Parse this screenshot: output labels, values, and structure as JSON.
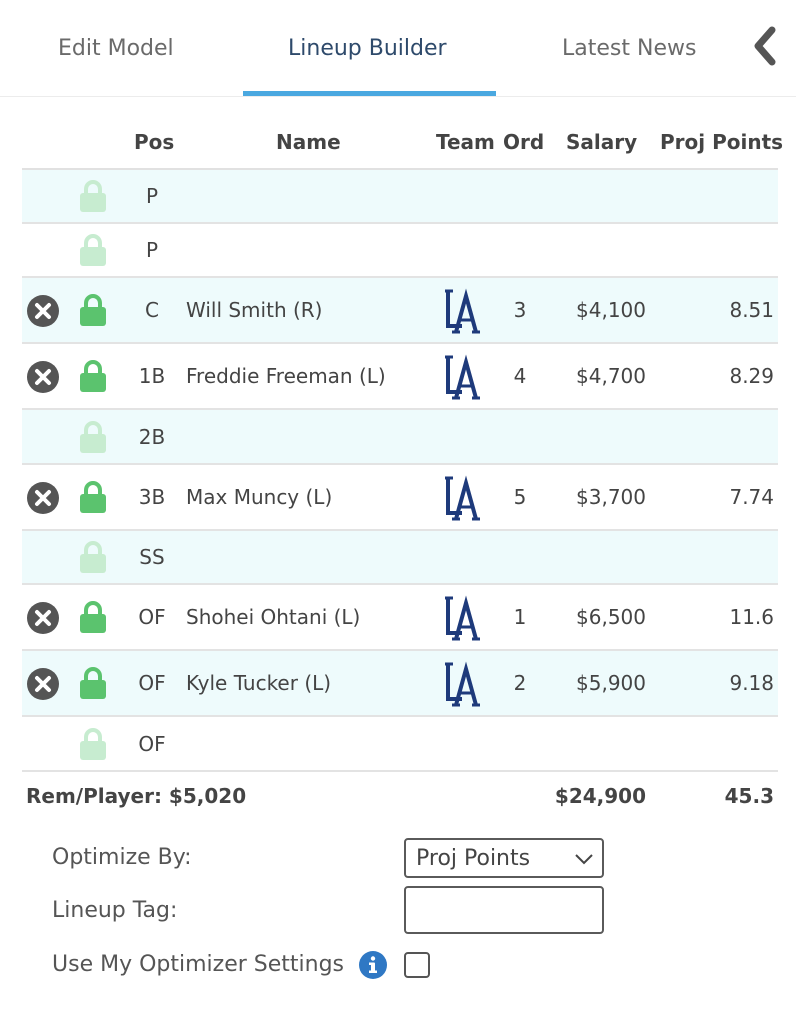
{
  "tabs": [
    {
      "label": "Edit Model"
    },
    {
      "label": "Lineup Builder"
    },
    {
      "label": "Latest News"
    }
  ],
  "table": {
    "headers": {
      "pos": "Pos",
      "name": "Name",
      "team": "Team",
      "ord": "Ord",
      "salary": "Salary",
      "proj_points": "Proj Points"
    },
    "rows": [
      {
        "pos": "P",
        "filled": false
      },
      {
        "pos": "P",
        "filled": false
      },
      {
        "pos": "C",
        "filled": true,
        "name": "Will Smith (R)",
        "team_icon": "dodgers-la-logo",
        "ord": "3",
        "salary": "$4,100",
        "proj_points": "8.51"
      },
      {
        "pos": "1B",
        "filled": true,
        "name": "Freddie Freeman (L)",
        "team_icon": "dodgers-la-logo",
        "ord": "4",
        "salary": "$4,700",
        "proj_points": "8.29"
      },
      {
        "pos": "2B",
        "filled": false
      },
      {
        "pos": "3B",
        "filled": true,
        "name": "Max Muncy (L)",
        "team_icon": "dodgers-la-logo",
        "ord": "5",
        "salary": "$3,700",
        "proj_points": "7.74"
      },
      {
        "pos": "SS",
        "filled": false
      },
      {
        "pos": "OF",
        "filled": true,
        "name": "Shohei Ohtani (L)",
        "team_icon": "dodgers-la-logo",
        "ord": "1",
        "salary": "$6,500",
        "proj_points": "11.6"
      },
      {
        "pos": "OF",
        "filled": true,
        "name": "Kyle Tucker (L)",
        "team_icon": "dodgers-la-logo",
        "ord": "2",
        "salary": "$5,900",
        "proj_points": "9.18"
      },
      {
        "pos": "OF",
        "filled": false
      }
    ],
    "totals": {
      "rem_per_player": "Rem/Player: $5,020",
      "salary": "$24,900",
      "proj_points": "45.3"
    }
  },
  "form": {
    "optimize_by_label": "Optimize By:",
    "optimize_by_value": "Proj Points",
    "lineup_tag_label": "Lineup Tag:",
    "lineup_tag_value": "",
    "use_settings_label": "Use My Optimizer Settings",
    "use_settings_checked": false
  },
  "colors": {
    "accent": "#4aa8e0",
    "lock_active": "#5bc36e",
    "lock_inactive": "#c7ecd0",
    "row_shade": "#eefbfc",
    "team_navy": "#1e3a7b",
    "info_blue": "#2f78c4"
  }
}
